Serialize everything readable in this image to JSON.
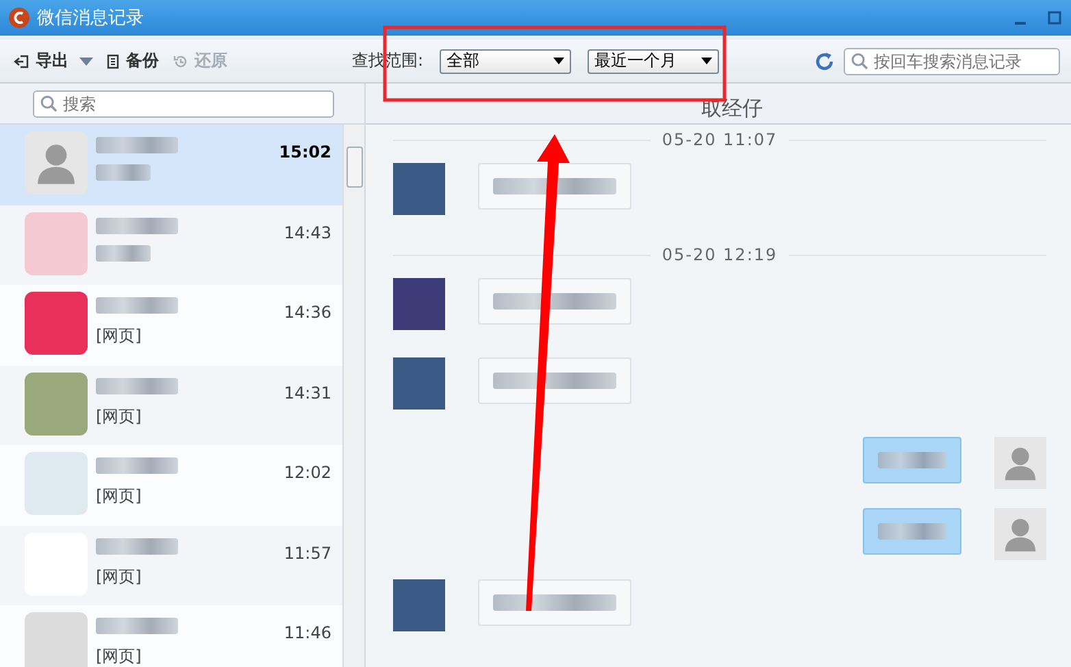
{
  "window": {
    "title": "微信消息记录"
  },
  "toolbar": {
    "buttons": [
      {
        "label": "导出",
        "disabled": false,
        "dropdown": true,
        "kind": "export"
      },
      {
        "label": "备份",
        "disabled": false,
        "dropdown": false,
        "kind": "backup"
      },
      {
        "label": "还原",
        "disabled": true,
        "dropdown": false,
        "kind": "restore"
      }
    ],
    "range_label": "查找范围:",
    "range_select": "全部",
    "period_select": "最近一个月",
    "search": {
      "placeholder": "按回车搜索消息记录"
    }
  },
  "contact_search": {
    "placeholder": "搜索"
  },
  "chat_title": "取经仔",
  "contacts": [
    {
      "time": "15:02",
      "selected": true
    },
    {
      "time": "14:43",
      "selected": false
    },
    {
      "time": "14:36",
      "preview": "[网页]",
      "selected": false
    },
    {
      "time": "14:31",
      "preview": "[网页]",
      "selected": false
    },
    {
      "time": "12:02",
      "preview": "[网页]",
      "selected": false
    },
    {
      "time": "11:57",
      "preview": "[网页]",
      "selected": false
    },
    {
      "time": "11:46",
      "preview": "[网页]",
      "selected": false
    }
  ],
  "messages": [
    {
      "kind": "divider",
      "time": "05-20 11:07"
    },
    {
      "kind": "incoming"
    },
    {
      "kind": "divider",
      "time": "05-20 12:19"
    },
    {
      "kind": "incoming"
    },
    {
      "kind": "incoming"
    },
    {
      "kind": "outgoing"
    },
    {
      "kind": "outgoing"
    },
    {
      "kind": "incoming"
    }
  ]
}
